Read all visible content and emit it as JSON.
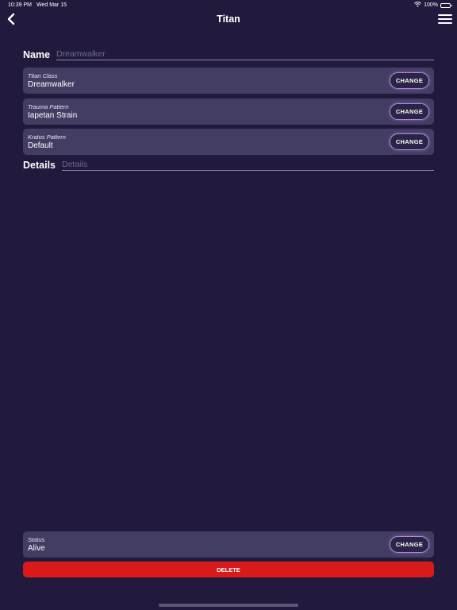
{
  "status_bar": {
    "time": "10:39 PM",
    "date": "Wed Mar 15",
    "battery": "100%",
    "icons": [
      "wifi-icon",
      "battery-icon"
    ]
  },
  "nav": {
    "title": "Titan",
    "back_icon": "chevron-left-icon",
    "menu_icon": "hamburger-menu-icon"
  },
  "name_field": {
    "label": "Name",
    "placeholder": "Dreamwalker",
    "value": ""
  },
  "cards": [
    {
      "caption": "Titan Class",
      "value": "Dreamwalker",
      "button": "CHANGE"
    },
    {
      "caption": "Trauma Pattern",
      "value": "Iapetan Strain",
      "button": "CHANGE"
    },
    {
      "caption": "Kratos Pattern",
      "value": "Default",
      "button": "CHANGE"
    }
  ],
  "details_field": {
    "label": "Details",
    "placeholder": "Details",
    "value": ""
  },
  "status_card": {
    "caption": "Status",
    "value": "Alive",
    "button": "CHANGE"
  },
  "delete_button": "DELETE",
  "colors": {
    "background": "#211a3d",
    "card": "#443d63",
    "button_border": "#b08ad8",
    "delete": "#d91a1a"
  }
}
